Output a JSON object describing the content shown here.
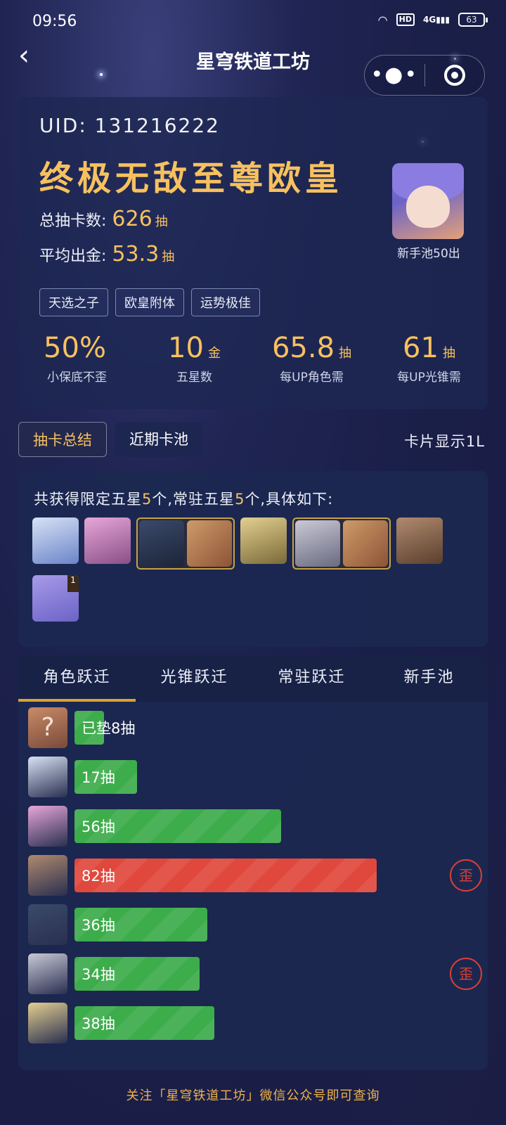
{
  "status": {
    "time": "09:56",
    "network": "4G",
    "hd": "HD",
    "battery": "63"
  },
  "nav": {
    "title": "星穹铁道工坊",
    "back_icon": "back-chevron-icon"
  },
  "summary": {
    "uid": "UID: 131216222",
    "rank_title": "终极无敌至尊欧皇",
    "total_label": "总抽卡数:",
    "total_value": "626",
    "total_unit": "抽",
    "avg_label": "平均出金:",
    "avg_value": "53.3",
    "avg_unit": "抽",
    "tags": [
      "天选之子",
      "欧皇附体",
      "运势极佳"
    ],
    "avatar_caption": "新手池50出",
    "metrics": [
      {
        "value": "50%",
        "unit": "",
        "label": "小保底不歪"
      },
      {
        "value": "10",
        "unit": "金",
        "label": "五星数"
      },
      {
        "value": "65.8",
        "unit": "抽",
        "label": "每UP角色需"
      },
      {
        "value": "61",
        "unit": "抽",
        "label": "每UP光锥需"
      }
    ]
  },
  "tabs": {
    "items": [
      "抽卡总结",
      "近期卡池"
    ],
    "active": 0,
    "display_mode": "卡片显示1L"
  },
  "gain": {
    "prefix": "共获得限定五星",
    "limited_count": "5",
    "mid": "个,常驻五星",
    "standard_count": "5",
    "suffix": "个,具体如下:",
    "badge": "1"
  },
  "warp_tabs": {
    "items": [
      "角色跃迁",
      "光锥跃迁",
      "常驻跃迁",
      "新手池"
    ],
    "active": 0
  },
  "bars": [
    {
      "label": "已垫8抽",
      "pulls": 8,
      "color": "green",
      "unknown": true,
      "wai": false,
      "unknown_mark": "?"
    },
    {
      "label": "17抽",
      "pulls": 17,
      "color": "green",
      "unknown": false,
      "wai": false
    },
    {
      "label": "56抽",
      "pulls": 56,
      "color": "green",
      "unknown": false,
      "wai": false
    },
    {
      "label": "82抽",
      "pulls": 82,
      "color": "red",
      "unknown": false,
      "wai": true
    },
    {
      "label": "36抽",
      "pulls": 36,
      "color": "green",
      "unknown": false,
      "wai": false
    },
    {
      "label": "34抽",
      "pulls": 34,
      "color": "green",
      "unknown": false,
      "wai": true
    },
    {
      "label": "38抽",
      "pulls": 38,
      "color": "green",
      "unknown": false,
      "wai": false
    }
  ],
  "wai_mark": "歪",
  "footer": "关注「星穹铁道工坊」微信公众号即可查询"
}
